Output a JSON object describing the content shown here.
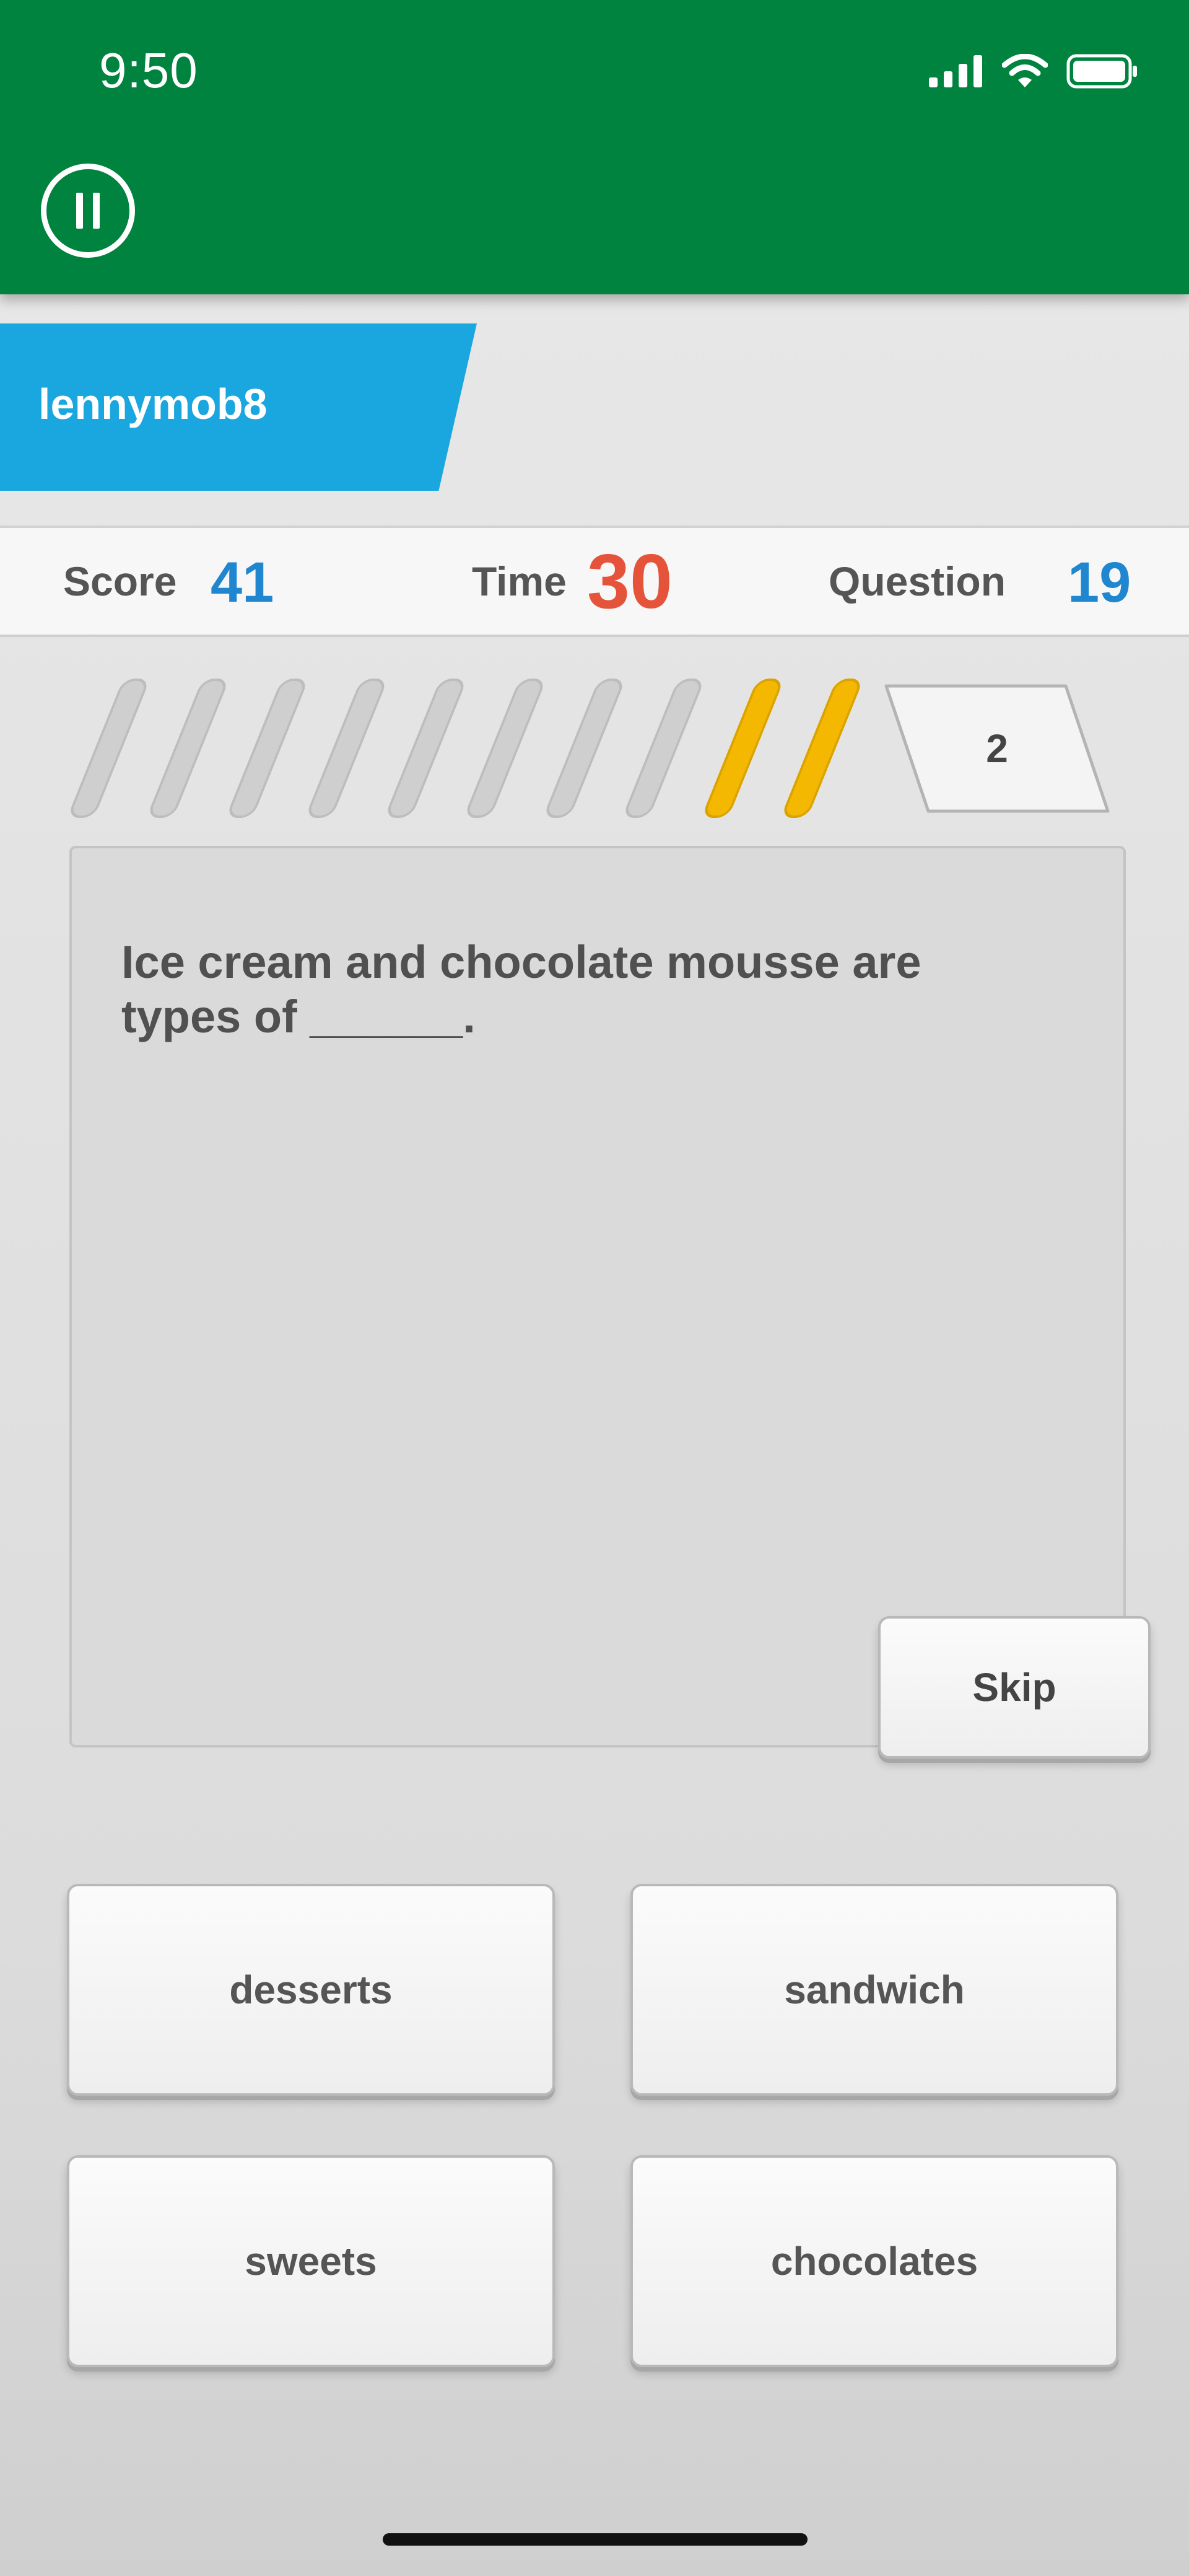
{
  "status_bar": {
    "time": "9:50",
    "icons": [
      "cellular-signal-icon",
      "wifi-icon",
      "battery-icon"
    ]
  },
  "header": {
    "background_color": "#00833f",
    "pause_icon": "pause-icon"
  },
  "player": {
    "name": "lennymob8",
    "tab_color": "#1aa6de"
  },
  "stats": {
    "score_label": "Score",
    "score_value": "41",
    "time_label": "Time",
    "time_value": "30",
    "question_label": "Question",
    "question_value": "19"
  },
  "progress": {
    "total_stripes": 10,
    "filled_stripes": 2,
    "filled_color": "#f5b800",
    "empty_color": "#cfcfcf",
    "counter": "2"
  },
  "question": {
    "text": "Ice cream and chocolate mousse are types of ______."
  },
  "skip_label": "Skip",
  "answers": [
    {
      "label": "desserts"
    },
    {
      "label": "sandwich"
    },
    {
      "label": "sweets"
    },
    {
      "label": "chocolates"
    }
  ]
}
